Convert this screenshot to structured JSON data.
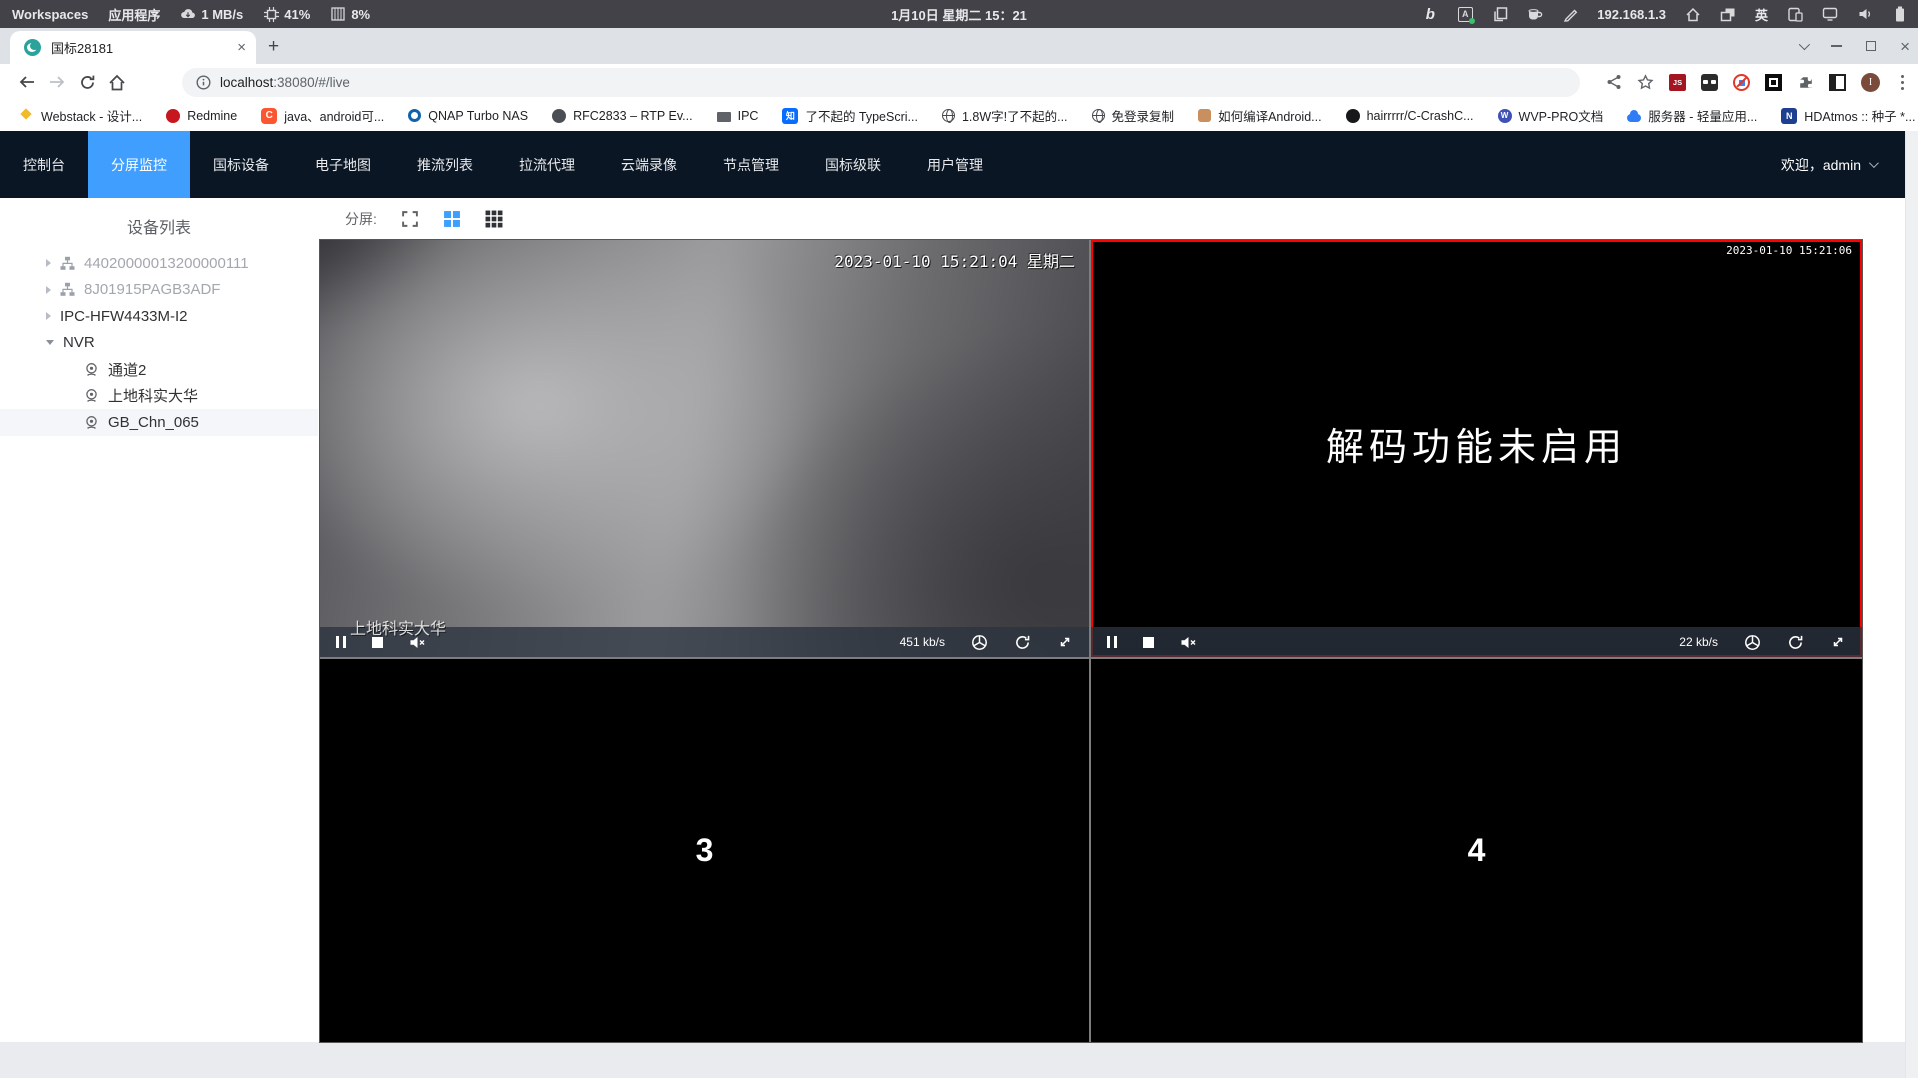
{
  "desktop": {
    "workspaces": "Workspaces",
    "apps": "应用程序",
    "net": "1 MB/s",
    "cpu": "41%",
    "mem": "8%",
    "clock": "1月10日 星期二 15：21",
    "ip": "192.168.1.3",
    "lang": "英"
  },
  "browser": {
    "tab": "国标28181",
    "new_tab": "+",
    "url_host": "localhost",
    "url_rest": ":38080/#/live",
    "js_badge": "JS",
    "avatar_initial": "I",
    "bookmarks": [
      {
        "label": "Webstack - 设计...",
        "glyph": ""
      },
      {
        "label": "Redmine",
        "glyph": ""
      },
      {
        "label": "java、android可...",
        "glyph": "C"
      },
      {
        "label": "QNAP Turbo NAS",
        "glyph": ""
      },
      {
        "label": "RFC2833 – RTP Ev...",
        "glyph": ""
      },
      {
        "label": "IPC",
        "glyph": ""
      },
      {
        "label": "了不起的 TypeScri...",
        "glyph": "知"
      },
      {
        "label": "1.8W字!了不起的...",
        "glyph": ""
      },
      {
        "label": "免登录复制",
        "glyph": ""
      },
      {
        "label": "如何编译Android...",
        "glyph": ""
      },
      {
        "label": "hairrrrr/C-CrashC...",
        "glyph": ""
      },
      {
        "label": "WVP-PRO文档",
        "glyph": "W"
      },
      {
        "label": "服务器 - 轻量应用...",
        "glyph": ""
      },
      {
        "label": "HDAtmos :: 种子 *...",
        "glyph": "N"
      }
    ],
    "bookmarks_overflow": "»"
  },
  "nav": {
    "items": [
      "控制台",
      "分屏监控",
      "国标设备",
      "电子地图",
      "推流列表",
      "拉流代理",
      "云端录像",
      "节点管理",
      "国标级联",
      "用户管理"
    ],
    "active": "分屏监控",
    "welcome": "欢迎，admin"
  },
  "sidebar": {
    "title": "设备列表",
    "tree": [
      {
        "label": "44020000013200000111",
        "status": "offline"
      },
      {
        "label": "8J01915PAGB3ADF",
        "status": "offline"
      },
      {
        "label": "IPC-HFW4433M-I2",
        "status": "online"
      },
      {
        "label": "NVR",
        "status": "online-expanded"
      },
      {
        "label": "通道2",
        "type": "channel"
      },
      {
        "label": "上地科实大华",
        "type": "channel"
      },
      {
        "label": "GB_Chn_065",
        "type": "channel",
        "selected": true
      }
    ]
  },
  "screen_toolbar": {
    "label": "分屏:"
  },
  "panels": {
    "p1": {
      "timestamp": "2023-01-10 15:21:04 星期二",
      "name": "上地科实大华",
      "bitrate": "451 kb/s"
    },
    "p2": {
      "timestamp": "2023-01-10 15:21:06",
      "message": "解码功能未启用",
      "bitrate": "22 kb/s",
      "selected": true
    },
    "p3": {
      "label": "3"
    },
    "p4": {
      "label": "4"
    }
  },
  "colors": {
    "accent": "#409eff",
    "nav_bg": "#0b1624",
    "selected_panel_border": "#fe0000",
    "control_bar": "#2b333f"
  }
}
